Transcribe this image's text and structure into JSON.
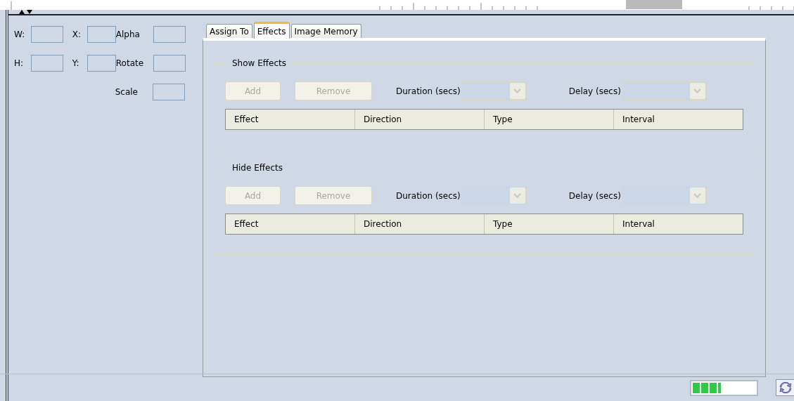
{
  "transform_fields": [
    [
      {
        "label": "W:"
      },
      {
        "label": "X:"
      },
      {
        "label": "Alpha"
      }
    ],
    [
      {
        "label": "H:"
      },
      {
        "label": "Y:"
      },
      {
        "label": "Rotate"
      }
    ],
    [
      {
        "label": "Scale"
      }
    ]
  ],
  "tabs": [
    {
      "label": "Assign To",
      "selected": false
    },
    {
      "label": "Effects",
      "selected": true
    },
    {
      "label": "Image Memory",
      "selected": false
    }
  ],
  "effect_groups": [
    {
      "title": "Show Effects",
      "buttons": [
        {
          "label": "Add",
          "disabled": true
        },
        {
          "label": "Remove",
          "disabled": true
        }
      ],
      "combos": [
        {
          "label": "Duration (secs)",
          "disabled": true
        },
        {
          "label": "Delay (secs)",
          "disabled": true
        }
      ],
      "columns": [
        "Effect",
        "Direction",
        "Type",
        "Interval"
      ]
    },
    {
      "title": "Hide Effects",
      "buttons": [
        {
          "label": "Add",
          "disabled": true
        },
        {
          "label": "Remove",
          "disabled": true
        }
      ],
      "combos": [
        {
          "label": "Duration (secs)",
          "disabled": true
        },
        {
          "label": "Delay (secs)",
          "disabled": true
        }
      ],
      "columns": [
        "Effect",
        "Direction",
        "Type",
        "Interval"
      ]
    }
  ],
  "status_bar": {
    "progress": {
      "level": 0.45
    }
  }
}
